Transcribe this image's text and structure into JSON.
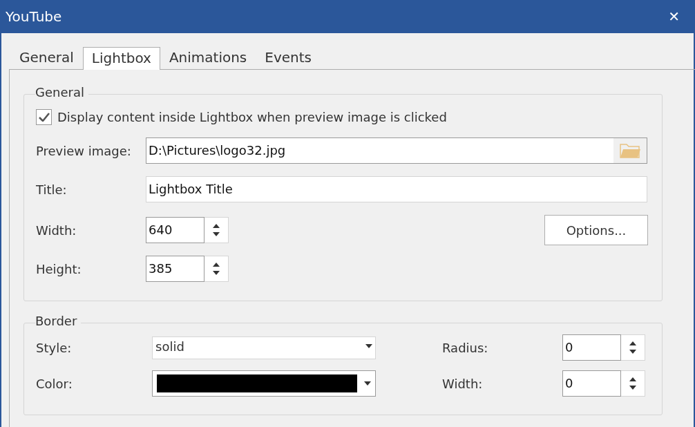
{
  "window": {
    "title": "YouTube",
    "close": "✕"
  },
  "tabs": [
    {
      "label": "General",
      "selected": false
    },
    {
      "label": "Lightbox",
      "selected": true
    },
    {
      "label": "Animations",
      "selected": false
    },
    {
      "label": "Events",
      "selected": false
    }
  ],
  "general": {
    "legend": "General",
    "display_checkbox": {
      "label": "Display content inside Lightbox when preview image is clicked",
      "checked": true
    },
    "preview_image": {
      "label": "Preview image:",
      "value": "D:\\Pictures\\logo32.jpg"
    },
    "title": {
      "label": "Title:",
      "value": "Lightbox Title"
    },
    "width": {
      "label": "Width:",
      "value": "640"
    },
    "height": {
      "label": "Height:",
      "value": "385"
    },
    "options_button": "Options..."
  },
  "border": {
    "legend": "Border",
    "style": {
      "label": "Style:",
      "value": "solid"
    },
    "color": {
      "label": "Color:",
      "color": "#000000"
    },
    "radius": {
      "label": "Radius:",
      "value": "0"
    },
    "width": {
      "label": "Width:",
      "value": "0"
    }
  }
}
